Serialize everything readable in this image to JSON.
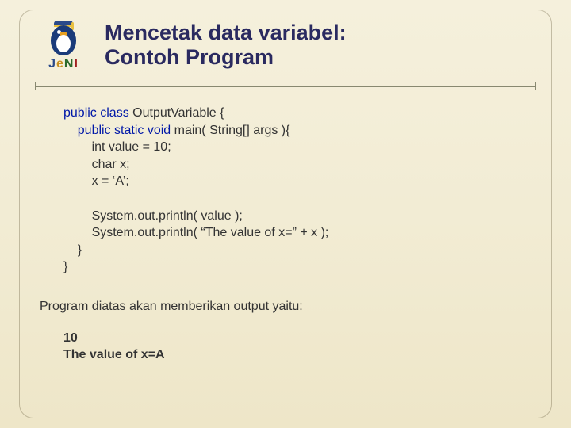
{
  "logo": {
    "j": "J",
    "e": "e",
    "n": "N",
    "i": "I"
  },
  "title_line1": "Mencetak data variabel:",
  "title_line2": "Contoh Program",
  "code": {
    "l1a": "public class ",
    "l1b": "OutputVariable {",
    "l2a": "    public static void ",
    "l2b": "main( String[] args ){",
    "l3": "        int value = 10;",
    "l4": "        char x;",
    "l5": "        x = ‘A’;",
    "blank1": "",
    "l6": "        System.out.println( value );",
    "l7": "        System.out.println( “The value of x=” + x );",
    "l8": "    }",
    "l9": "}"
  },
  "desc": "Program diatas akan memberikan output yaitu:",
  "output": {
    "o1": "10",
    "o2": "The value of x=A"
  }
}
